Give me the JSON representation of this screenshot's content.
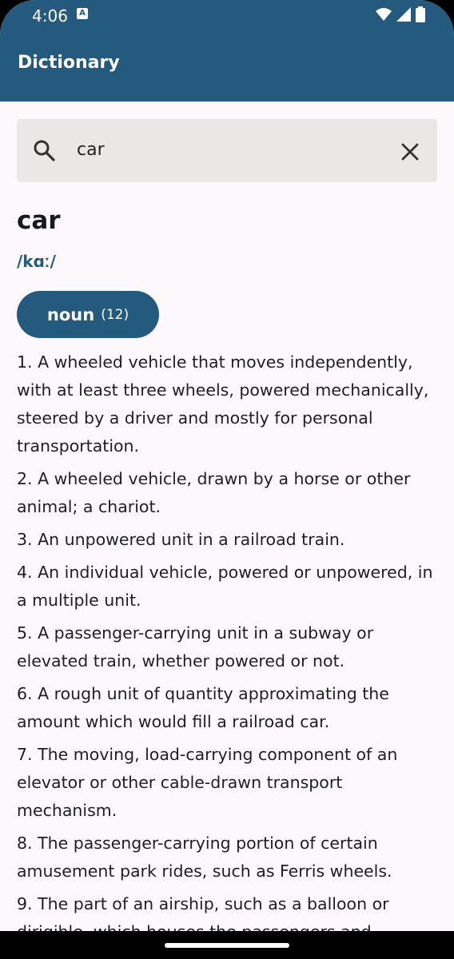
{
  "status_bar": {
    "time": "4:06",
    "notification_glyph": "A"
  },
  "app_bar": {
    "title": "Dictionary"
  },
  "search": {
    "value": "car"
  },
  "entry": {
    "word": "car",
    "phonetic": "/kɑː/",
    "part_of_speech": {
      "label": "noun",
      "count": "(12)"
    },
    "definitions": [
      {
        "num": "1.",
        "text": "A wheeled vehicle that moves independently, with at least three wheels, powered mechanically, steered by a driver and mostly for personal transportation."
      },
      {
        "num": "2.",
        "text": "A wheeled vehicle, drawn by a horse or other animal; a chariot."
      },
      {
        "num": "3.",
        "text": "An unpowered unit in a railroad train."
      },
      {
        "num": "4.",
        "text": "An individual vehicle, powered or unpowered, in a multiple unit."
      },
      {
        "num": "5.",
        "text": "A passenger-carrying unit in a subway or elevated train, whether powered or not."
      },
      {
        "num": "6.",
        "text": "A rough unit of quantity approximating the amount which would fill a railroad car."
      },
      {
        "num": "7.",
        "text": "The moving, load-carrying component of an elevator or other cable-drawn transport mechanism."
      },
      {
        "num": "8.",
        "text": "The passenger-carrying portion of certain amusement park rides, such as Ferris wheels."
      },
      {
        "num": "9.",
        "text": "The part of an airship, such as a balloon or dirigible, which houses the passengers and"
      }
    ]
  },
  "colors": {
    "primary": "#235a7e",
    "background": "#fdf8fc",
    "search_bg": "#ebe7e6"
  }
}
